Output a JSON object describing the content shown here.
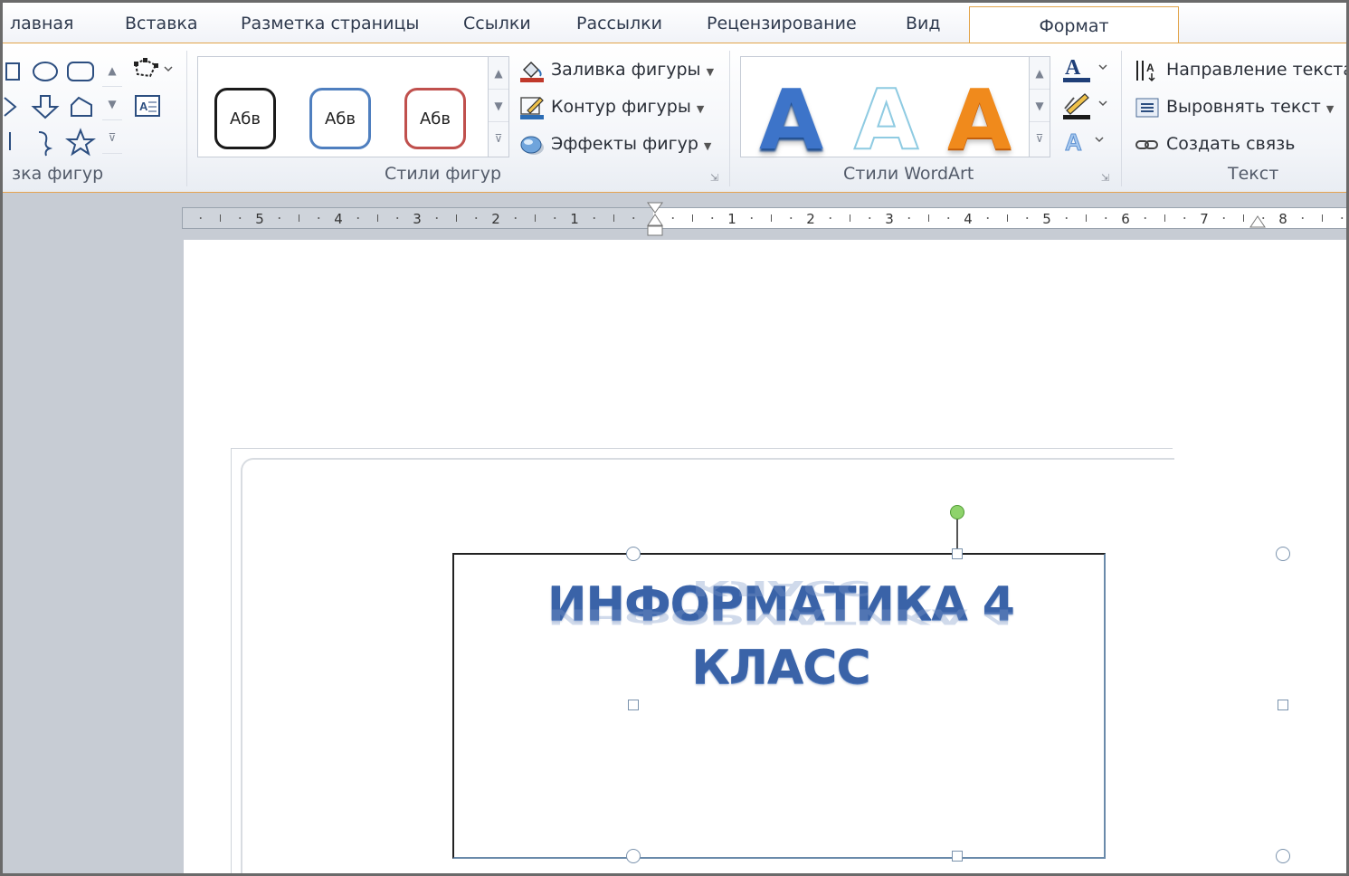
{
  "tabs": [
    "лавная",
    "Вставка",
    "Разметка страницы",
    "Ссылки",
    "Рассылки",
    "Рецензирование",
    "Вид"
  ],
  "active_tab": "Формат",
  "groups": {
    "insert_shapes": "зка фигур",
    "shape_styles": "Стили фигур",
    "wordart_styles": "Стили WordArt",
    "text": "Текст"
  },
  "shape_style_buttons": [
    {
      "label": "Абв",
      "border": "#1a1a1a"
    },
    {
      "label": "Абв",
      "border": "#4f7fbf"
    },
    {
      "label": "Абв",
      "border": "#c0504d"
    }
  ],
  "shape_commands": {
    "fill": "Заливка фигуры",
    "outline": "Контур фигуры",
    "effects": "Эффекты фигур"
  },
  "wordart_samples": [
    {
      "letter": "A",
      "color": "#3d74c9"
    },
    {
      "letter": "A",
      "color": "#9fd3e8"
    },
    {
      "letter": "A",
      "color": "#f08a1c"
    }
  ],
  "text_commands": {
    "direction": "Направление текста",
    "align": "Выровнять текст",
    "link": "Создать связь"
  },
  "ruler": {
    "left_numbers": [
      "5",
      "4",
      "3",
      "2",
      "1"
    ],
    "right_numbers": [
      "1",
      "2",
      "3",
      "4",
      "5",
      "6",
      "7",
      "8"
    ]
  },
  "document": {
    "wordart_text": "ИНФОРМАТИКА 4 КЛАСС"
  },
  "colors": {
    "accent": "#e6a350",
    "wordart": "#3a63a8"
  }
}
